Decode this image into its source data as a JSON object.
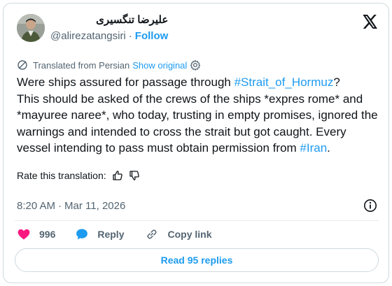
{
  "author": {
    "display_name": "علیرضا تنگسیری",
    "handle": "@alirezatangsiri",
    "separator": "·",
    "follow_label": "Follow"
  },
  "translation": {
    "label": "Translated from Persian",
    "show_original": "Show original"
  },
  "tweet": {
    "line1_pre": "Were ships assured for passage through ",
    "hashtag1": "#Strait_of_Hormuz",
    "line1_post": "?",
    "body": "This should be asked of the crews of the ships *expres rome* and *mayuree naree*, who today, trusting in empty promises, ignored the warnings and intended to cross the strait but got caught. Every vessel intending to pass must obtain permission from ",
    "hashtag2": "#Iran",
    "end": "."
  },
  "rate": {
    "label": "Rate this translation:"
  },
  "timestamp": {
    "time": "8:20 AM",
    "separator": "·",
    "date": "Mar 11, 2026"
  },
  "actions": {
    "like_count": "996",
    "reply_label": "Reply",
    "copy_link_label": "Copy link"
  },
  "read_replies_label": "Read 95 replies",
  "colors": {
    "accent": "#1d9bf0",
    "like": "#f91880",
    "text": "#0f1419",
    "muted": "#536471"
  }
}
